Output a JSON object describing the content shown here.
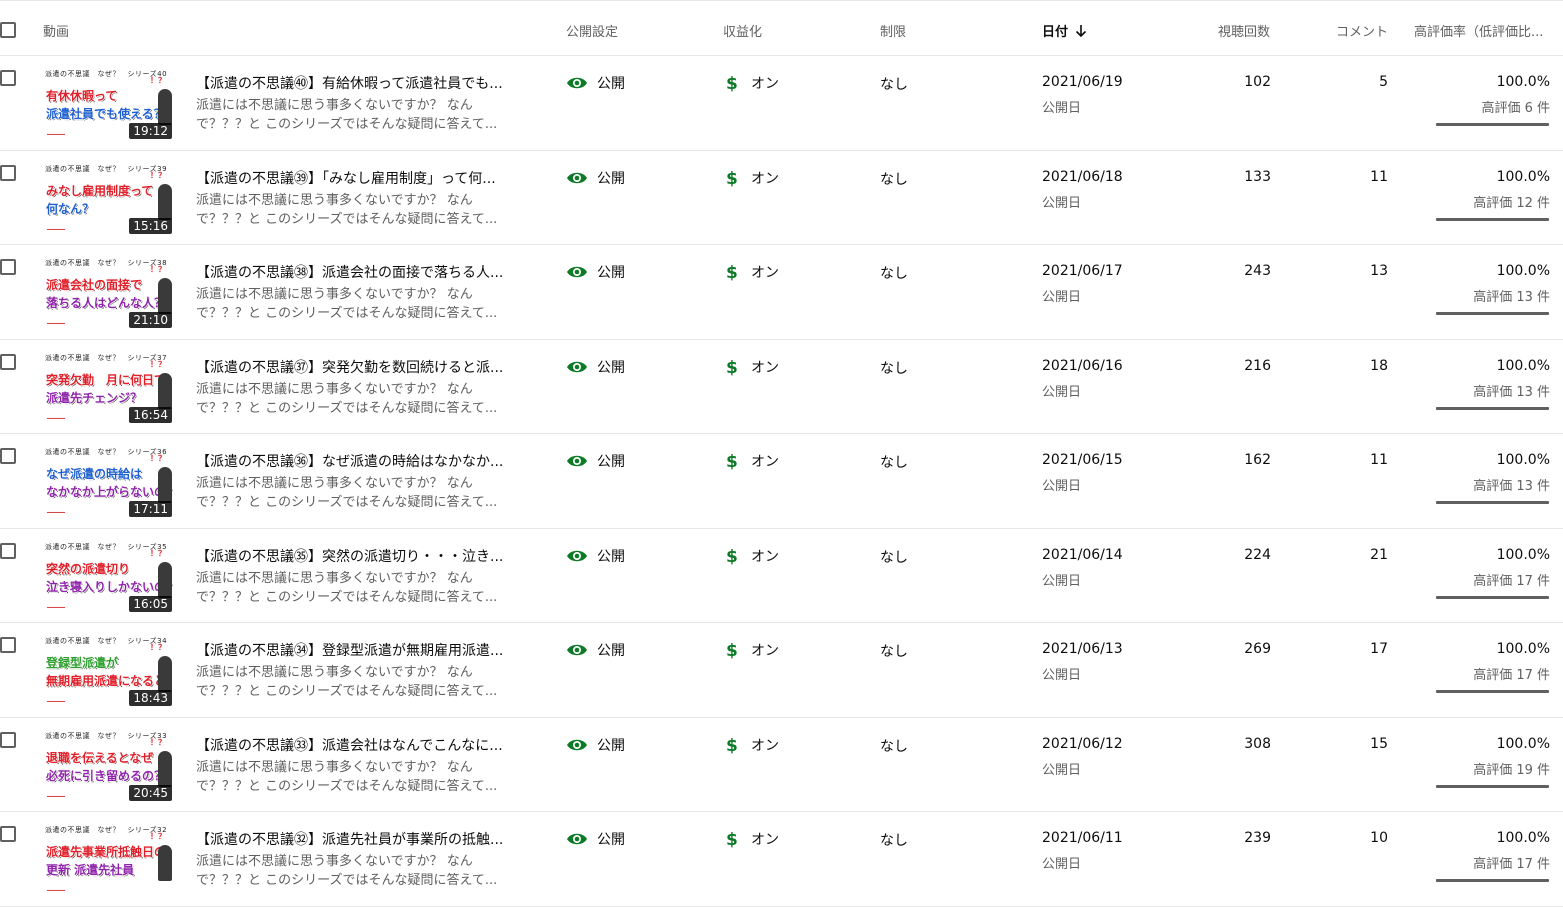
{
  "colors": {
    "visibility_icon": "#0c7a26",
    "monetization_icon": "#0c7a26",
    "border": "#e6e6e6",
    "secondary_text": "#606060"
  },
  "header": {
    "video": "動画",
    "visibility": "公開設定",
    "monetization": "収益化",
    "restrictions": "制限",
    "date": "日付",
    "date_sort_icon": "arrow-down-icon",
    "views": "視聴回数",
    "comments": "コメント",
    "likes": "高評価率（低評価比..."
  },
  "rows": [
    {
      "thumb": {
        "series": "派遣の不思議　なぜ？　シリーズ40",
        "line1": "有休休暇って",
        "line2": "派遣社員でも使える？",
        "line1_color": "#e0202a",
        "line2_color": "#1f5fd0",
        "duration": "19:12"
      },
      "title": "【派遣の不思議㊵】有給休暇って派遣社員でも...",
      "description": "派遣には不思議に思う事多くないですか？ なんで？？？と このシリーズではそんな疑問に答えて...",
      "visibility": "公開",
      "monetization": "オン",
      "restrictions": "なし",
      "date": "2021/06/19",
      "date_label": "公開日",
      "views": "102",
      "comments": "5",
      "like_rate": "100.0%",
      "likes": "高評価 6 件",
      "like_ratio": 1.0
    },
    {
      "thumb": {
        "series": "派遣の不思議　なぜ？　シリーズ39",
        "line1": "みなし雇用制度って",
        "line2": "何なん？",
        "line1_color": "#e0202a",
        "line2_color": "#1f5fd0",
        "duration": "15:16"
      },
      "title": "【派遣の不思議㊴】「みなし雇用制度」って何...",
      "description": "派遣には不思議に思う事多くないですか？ なんで？？？と このシリーズではそんな疑問に答えて...",
      "visibility": "公開",
      "monetization": "オン",
      "restrictions": "なし",
      "date": "2021/06/18",
      "date_label": "公開日",
      "views": "133",
      "comments": "11",
      "like_rate": "100.0%",
      "likes": "高評価 12 件",
      "like_ratio": 1.0
    },
    {
      "thumb": {
        "series": "派遣の不思議　なぜ？　シリーズ38",
        "line1": "派遣会社の面接で",
        "line2": "落ちる人はどんな人？",
        "line1_color": "#e0202a",
        "line2_color": "#8e24aa",
        "duration": "21:10"
      },
      "title": "【派遣の不思議㊳】派遣会社の面接で落ちる人...",
      "description": "派遣には不思議に思う事多くないですか？ なんで？？？と このシリーズではそんな疑問に答えて...",
      "visibility": "公開",
      "monetization": "オン",
      "restrictions": "なし",
      "date": "2021/06/17",
      "date_label": "公開日",
      "views": "243",
      "comments": "13",
      "like_rate": "100.0%",
      "likes": "高評価 13 件",
      "like_ratio": 1.0
    },
    {
      "thumb": {
        "series": "派遣の不思議　なぜ？　シリーズ37",
        "line1": "突発欠勤　月に何日で",
        "line2": "派遣先チェンジ？",
        "line1_color": "#e0202a",
        "line2_color": "#8e24aa",
        "duration": "16:54"
      },
      "title": "【派遣の不思議㊲】突発欠勤を数回続けると派...",
      "description": "派遣には不思議に思う事多くないですか？ なんで？？？と このシリーズではそんな疑問に答えて...",
      "visibility": "公開",
      "monetization": "オン",
      "restrictions": "なし",
      "date": "2021/06/16",
      "date_label": "公開日",
      "views": "216",
      "comments": "18",
      "like_rate": "100.0%",
      "likes": "高評価 13 件",
      "like_ratio": 1.0
    },
    {
      "thumb": {
        "series": "派遣の不思議　なぜ？　シリーズ36",
        "line1": "なぜ派遣の時給は",
        "line2": "なかなか上がらないの？",
        "line1_color": "#1f5fd0",
        "line2_color": "#8e24aa",
        "duration": "17:11"
      },
      "title": "【派遣の不思議㊱】なぜ派遣の時給はなかなか...",
      "description": "派遣には不思議に思う事多くないですか？ なんで？？？と このシリーズではそんな疑問に答えて...",
      "visibility": "公開",
      "monetization": "オン",
      "restrictions": "なし",
      "date": "2021/06/15",
      "date_label": "公開日",
      "views": "162",
      "comments": "11",
      "like_rate": "100.0%",
      "likes": "高評価 13 件",
      "like_ratio": 1.0
    },
    {
      "thumb": {
        "series": "派遣の不思議　なぜ？　シリーズ35",
        "line1": "突然の派遣切り",
        "line2": "泣き寝入りしかないの？",
        "line1_color": "#e0202a",
        "line2_color": "#8e24aa",
        "duration": "16:05"
      },
      "title": "【派遣の不思議㉟】突然の派遣切り・・・泣き...",
      "description": "派遣には不思議に思う事多くないですか？ なんで？？？と このシリーズではそんな疑問に答えて...",
      "visibility": "公開",
      "monetization": "オン",
      "restrictions": "なし",
      "date": "2021/06/14",
      "date_label": "公開日",
      "views": "224",
      "comments": "21",
      "like_rate": "100.0%",
      "likes": "高評価 17 件",
      "like_ratio": 1.0
    },
    {
      "thumb": {
        "series": "派遣の不思議　なぜ？　シリーズ34",
        "line1": "登録型派遣が",
        "line2": "無期雇用派遣になると",
        "line1_color": "#2e9e2e",
        "line2_color": "#e0202a",
        "duration": "18:43"
      },
      "title": "【派遣の不思議㉞】登録型派遣が無期雇用派遣...",
      "description": "派遣には不思議に思う事多くないですか？ なんで？？？と このシリーズではそんな疑問に答えて...",
      "visibility": "公開",
      "monetization": "オン",
      "restrictions": "なし",
      "date": "2021/06/13",
      "date_label": "公開日",
      "views": "269",
      "comments": "17",
      "like_rate": "100.0%",
      "likes": "高評価 17 件",
      "like_ratio": 1.0
    },
    {
      "thumb": {
        "series": "派遣の不思議　なぜ？　シリーズ33",
        "line1": "退職を伝えるとなぜ",
        "line2": "必死に引き留めるの？",
        "line1_color": "#e0202a",
        "line2_color": "#8e24aa",
        "duration": "20:45"
      },
      "title": "【派遣の不思議㉝】派遣会社はなんでこんなに...",
      "description": "派遣には不思議に思う事多くないですか？ なんで？？？と このシリーズではそんな疑問に答えて...",
      "visibility": "公開",
      "monetization": "オン",
      "restrictions": "なし",
      "date": "2021/06/12",
      "date_label": "公開日",
      "views": "308",
      "comments": "15",
      "like_rate": "100.0%",
      "likes": "高評価 19 件",
      "like_ratio": 1.0
    },
    {
      "thumb": {
        "series": "派遣の不思議　なぜ？　シリーズ32",
        "line1": "派遣先事業所抵触日の",
        "line2": "更新 派遣先社員",
        "line1_color": "#e0202a",
        "line2_color": "#8e24aa",
        "duration": ""
      },
      "title": "【派遣の不思議㉜】派遣先社員が事業所の抵触...",
      "description": "派遣には不思議に思う事多くないですか？ なんで？？？と このシリーズではそんな疑問に答えて...",
      "visibility": "公開",
      "monetization": "オン",
      "restrictions": "なし",
      "date": "2021/06/11",
      "date_label": "公開日",
      "views": "239",
      "comments": "10",
      "like_rate": "100.0%",
      "likes": "高評価 17 件",
      "like_ratio": 1.0
    }
  ]
}
